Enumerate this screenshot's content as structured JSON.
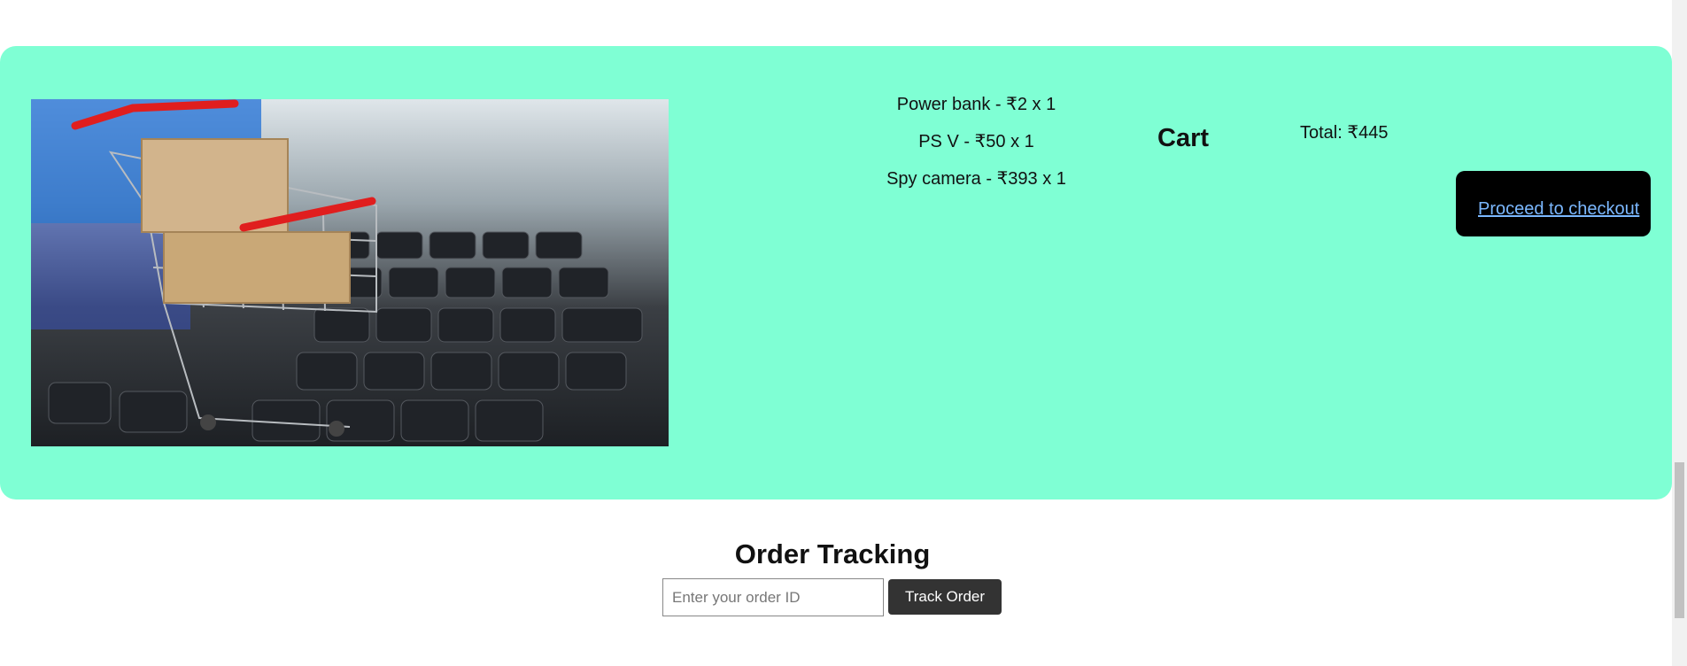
{
  "cart": {
    "title": "Cart",
    "items": [
      {
        "text": "Power bank - ₹2 x 1"
      },
      {
        "text": "PS V - ₹50 x 1"
      },
      {
        "text": "Spy camera - ₹393 x 1"
      }
    ],
    "total": "Total: ₹445",
    "checkout_label": "Proceed to checkout"
  },
  "tracking": {
    "title": "Order Tracking",
    "input_placeholder": "Enter your order ID",
    "input_value": "",
    "button_label": "Track Order"
  },
  "colors": {
    "panel_bg": "#7fffd4",
    "checkout_bg": "#000000",
    "checkout_link": "#7bb8ff",
    "track_button_bg": "#333333"
  },
  "icons": {
    "hero_image": "shopping-cart-on-laptop-keyboard-image"
  }
}
